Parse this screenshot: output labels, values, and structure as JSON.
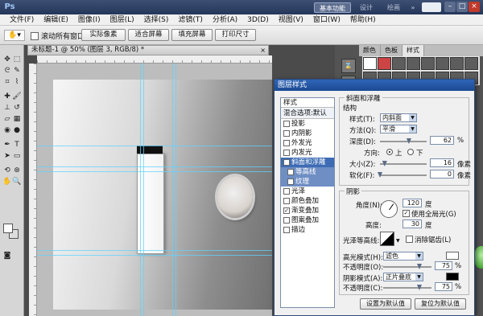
{
  "app": {
    "logo": "Ps",
    "workspace_basic": "基本功能",
    "workspace_design": "设计",
    "workspace_paint": "绘画",
    "more": "»",
    "win_min": "–",
    "win_max": "□",
    "win_close": "×"
  },
  "menu": [
    "文件(F)",
    "编辑(E)",
    "图像(I)",
    "图层(L)",
    "选择(S)",
    "滤镜(T)",
    "分析(A)",
    "3D(D)",
    "视图(V)",
    "窗口(W)",
    "帮助(H)"
  ],
  "options": {
    "scroll_all_label": "滚动所有窗口",
    "btn_actual": "实际像素",
    "btn_fit": "适合屏幕",
    "btn_fill": "填充屏幕",
    "btn_print": "打印尺寸"
  },
  "document": {
    "tab_title": "未标题-1 @ 50% (图层 3, RGB/8) *",
    "close": "×"
  },
  "panel_tabs": [
    "颜色",
    "色板",
    "样式"
  ],
  "dialog": {
    "title": "图层样式",
    "list_header": "样式",
    "blend_header": "混合选项:默认",
    "effects": [
      {
        "label": "投影",
        "checked": false
      },
      {
        "label": "内阴影",
        "checked": false
      },
      {
        "label": "外发光",
        "checked": false
      },
      {
        "label": "内发光",
        "checked": false
      },
      {
        "label": "斜面和浮雕",
        "checked": true,
        "selected": true
      },
      {
        "label": "等高线",
        "checked": false,
        "sub": true
      },
      {
        "label": "纹理",
        "checked": false,
        "sub": true
      },
      {
        "label": "光泽",
        "checked": false
      },
      {
        "label": "颜色叠加",
        "checked": false
      },
      {
        "label": "渐变叠加",
        "checked": true
      },
      {
        "label": "图案叠加",
        "checked": false
      },
      {
        "label": "描边",
        "checked": false
      }
    ],
    "bevel": {
      "section_title": "斜面和浮雕",
      "structure_title": "结构",
      "style_label": "样式(T):",
      "style_value": "内斜面",
      "technique_label": "方法(Q):",
      "technique_value": "平滑",
      "depth_label": "深度(D):",
      "depth_value": "62",
      "depth_unit": "%",
      "depth_fraction": 0.62,
      "direction_label": "方向:",
      "dir_up": "上",
      "dir_down": "下",
      "size_label": "大小(Z):",
      "size_value": "16",
      "size_unit": "像素",
      "size_fraction": 0.1,
      "soften_label": "软化(F):",
      "soften_value": "0",
      "soften_unit": "像素"
    },
    "shading": {
      "title": "阴影",
      "angle_label": "角度(N):",
      "angle_value": "120",
      "angle_unit": "度",
      "global_light_label": "使用全局光(G)",
      "altitude_label": "高度:",
      "altitude_value": "30",
      "altitude_unit": "度",
      "gloss_label": "光泽等高线:",
      "antialias_label": "消除锯齿(L)",
      "highlight_label": "高光模式(H):",
      "highlight_mode": "滤色",
      "highlight_color": "#ffffff",
      "highlight_opacity_label": "不透明度(O):",
      "highlight_opacity": "75",
      "highlight_fraction": 0.75,
      "shadow_label": "阴影模式(A):",
      "shadow_mode": "正片叠底",
      "shadow_color": "#000000",
      "shadow_opacity_label": "不透明度(C):",
      "shadow_opacity": "75",
      "shadow_fraction": 0.75,
      "percent": "%"
    },
    "btn_default": "设置为默认值",
    "btn_reset": "复位为默认值"
  }
}
